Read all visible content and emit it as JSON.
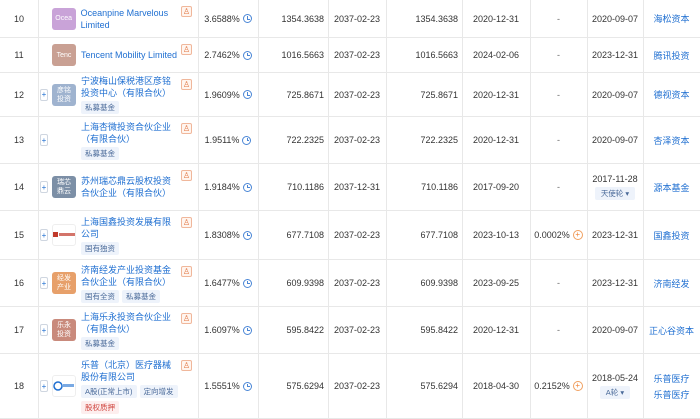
{
  "rows": [
    {
      "index": "10",
      "logo_text": "Ocea",
      "logo_color": "#c9a3d8",
      "name": "Oceanpine Marvelous Limited",
      "tags": [],
      "ratio": "3.6588%",
      "ratio_icon": "clock-icon",
      "subscribed": "1354.3638",
      "sub_date": "2037-02-23",
      "paid": "1354.3638",
      "paid_date": "2020-12-31",
      "latest_ratio": "-",
      "first_date": "2020-09-07",
      "round_tag": "",
      "brand": "海松资本",
      "brand2": ""
    },
    {
      "index": "11",
      "logo_text": "Tenc",
      "logo_color": "#c9a093",
      "name": "Tencent Mobility Limited",
      "tags": [],
      "ratio": "2.7462%",
      "ratio_icon": "clock-icon",
      "subscribed": "1016.5663",
      "sub_date": "2037-02-23",
      "paid": "1016.5663",
      "paid_date": "2024-02-06",
      "latest_ratio": "-",
      "first_date": "2023-12-31",
      "round_tag": "",
      "brand": "腾讯投资",
      "brand2": ""
    },
    {
      "index": "12",
      "logo_text": "彦铭\n投资",
      "logo_color": "#9fb3cf",
      "name": "宁波梅山保税港区彦铭投资中心（有限合伙）",
      "tags": [
        "私募基金"
      ],
      "ratio": "1.9609%",
      "ratio_icon": "clock-icon",
      "subscribed": "725.8671",
      "sub_date": "2037-02-23",
      "paid": "725.8671",
      "paid_date": "2020-12-31",
      "latest_ratio": "-",
      "first_date": "2020-09-07",
      "round_tag": "",
      "brand": "德视资本",
      "brand2": ""
    },
    {
      "index": "13",
      "logo_text": "",
      "logo_color": "",
      "name": "上海杏微投资合伙企业（有限合伙）",
      "tags": [
        "私募基金"
      ],
      "ratio": "1.9511%",
      "ratio_icon": "clock-icon",
      "subscribed": "722.2325",
      "sub_date": "2037-02-23",
      "paid": "722.2325",
      "paid_date": "2020-12-31",
      "latest_ratio": "-",
      "first_date": "2020-09-07",
      "round_tag": "",
      "brand": "杏泽资本",
      "brand2": ""
    },
    {
      "index": "14",
      "logo_text": "瑞芯\n鼎云",
      "logo_color": "#7c8fa6",
      "name": "苏州瑞芯鼎云股权投资合伙企业（有限合伙）",
      "tags": [],
      "ratio": "1.9184%",
      "ratio_icon": "clock-icon",
      "subscribed": "710.1186",
      "sub_date": "2037-12-31",
      "paid": "710.1186",
      "paid_date": "2017-09-20",
      "latest_ratio": "-",
      "first_date": "2017-11-28",
      "round_tag": "天使轮",
      "brand": "源本基金",
      "brand2": ""
    },
    {
      "index": "15",
      "logo_text": "",
      "logo_color": "",
      "name": "上海国鑫投资发展有限公司",
      "tags": [
        "国有独资"
      ],
      "ratio": "1.8308%",
      "ratio_icon": "clock-icon",
      "subscribed": "677.7108",
      "sub_date": "2037-02-23",
      "paid": "677.7108",
      "paid_date": "2023-10-13",
      "latest_ratio": "0.0002%",
      "first_date": "2023-12-31",
      "round_tag": "",
      "brand": "国鑫投资",
      "brand2": ""
    },
    {
      "index": "16",
      "logo_text": "经发\n产业",
      "logo_color": "#e7a06a",
      "name": "济南经发产业投资基金合伙企业（有限合伙）",
      "tags": [
        "国有全资",
        "私募基金"
      ],
      "ratio": "1.6477%",
      "ratio_icon": "clock-icon",
      "subscribed": "609.9398",
      "sub_date": "2037-02-23",
      "paid": "609.9398",
      "paid_date": "2023-09-25",
      "latest_ratio": "-",
      "first_date": "2023-12-31",
      "round_tag": "",
      "brand": "济南经发",
      "brand2": ""
    },
    {
      "index": "17",
      "logo_text": "乐永\n投资",
      "logo_color": "#c98a7c",
      "name": "上海乐永投资合伙企业（有限合伙）",
      "tags": [
        "私募基金"
      ],
      "ratio": "1.6097%",
      "ratio_icon": "clock-icon",
      "subscribed": "595.8422",
      "sub_date": "2037-02-23",
      "paid": "595.8422",
      "paid_date": "2020-12-31",
      "latest_ratio": "-",
      "first_date": "2020-09-07",
      "round_tag": "",
      "brand": "正心谷资本",
      "brand2": ""
    },
    {
      "index": "18",
      "logo_text": "",
      "logo_color": "",
      "name": "乐普（北京）医疗器械股份有限公司",
      "tags": [
        "A股(正常上市)",
        "定向增发",
        "股权质押"
      ],
      "ratio": "1.5551%",
      "ratio_icon": "clock-icon",
      "subscribed": "575.6294",
      "sub_date": "2037-02-23",
      "paid": "575.6294",
      "paid_date": "2018-04-30",
      "latest_ratio": "0.2152%",
      "first_date": "2018-05-24",
      "round_tag": "A轮",
      "brand": "乐普医疗",
      "brand2": "乐普医疗"
    }
  ]
}
